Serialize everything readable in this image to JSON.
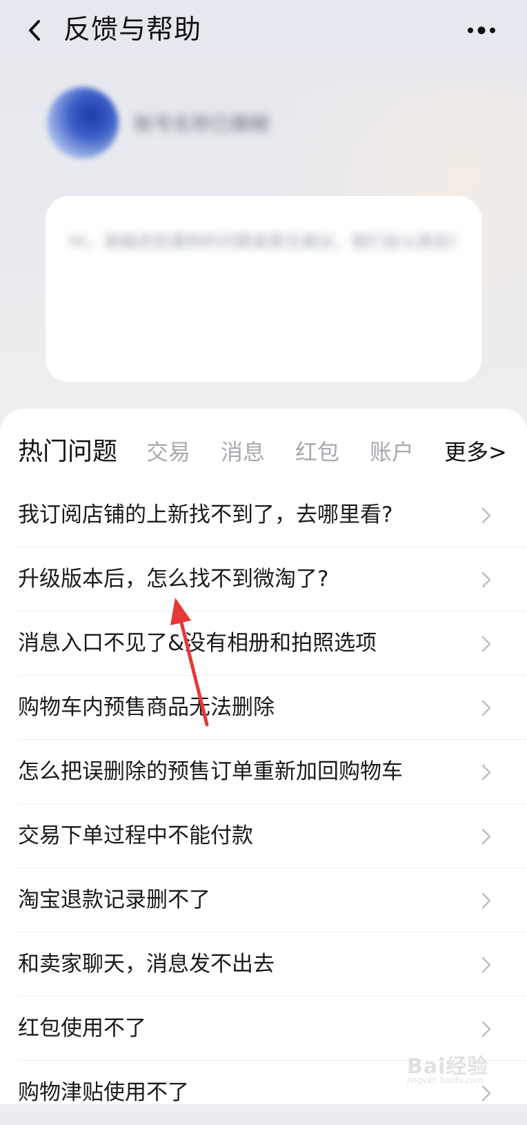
{
  "header": {
    "title": "反馈与帮助"
  },
  "profile": {
    "username": "账号名称已模糊",
    "input_placeholder": "Hi，请描述您遇到的问题或意见建议，我们会认真处理"
  },
  "tabs": [
    {
      "label": "热门问题",
      "active": true
    },
    {
      "label": "交易",
      "active": false
    },
    {
      "label": "消息",
      "active": false
    },
    {
      "label": "红包",
      "active": false
    },
    {
      "label": "账户",
      "active": false
    },
    {
      "label": "更多>",
      "active": false
    }
  ],
  "questions": [
    {
      "text": "我订阅店铺的上新找不到了，去哪里看?"
    },
    {
      "text": "升级版本后，怎么找不到微淘了?"
    },
    {
      "text": "消息入口不见了&没有相册和拍照选项"
    },
    {
      "text": "购物车内预售商品无法删除"
    },
    {
      "text": "怎么把误删除的预售订单重新加回购物车"
    },
    {
      "text": "交易下单过程中不能付款"
    },
    {
      "text": "淘宝退款记录删不了"
    },
    {
      "text": "和卖家聊天，消息发不出去"
    },
    {
      "text": "红包使用不了"
    },
    {
      "text": "购物津贴使用不了"
    }
  ],
  "watermark": {
    "brand": "Bai经验",
    "url": "jingyan.baidu.com"
  },
  "colors": {
    "annotation_arrow": "#e53935",
    "panel": "#ffffff",
    "inactive_tab": "#a7a9ae"
  }
}
